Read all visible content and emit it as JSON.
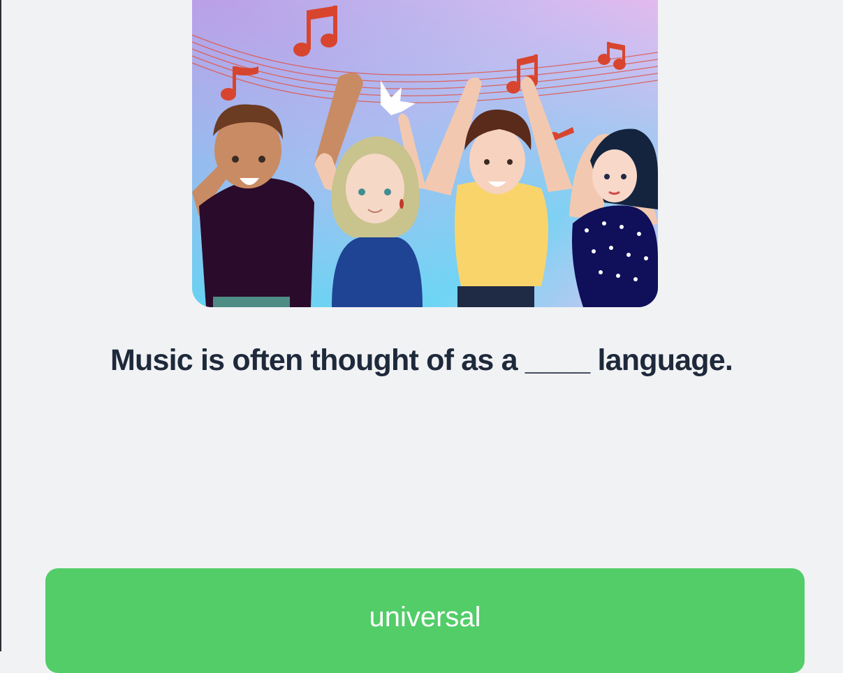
{
  "illustration": {
    "description_icon": "people-dancing-to-music-illustration"
  },
  "question": {
    "text": "Music is often thought of as a ____ language."
  },
  "answer": {
    "label": "universal"
  },
  "colors": {
    "background": "#f1f2f4",
    "question_text": "#1e293b",
    "answer_button": "#52cd68",
    "answer_text": "#ffffff"
  }
}
